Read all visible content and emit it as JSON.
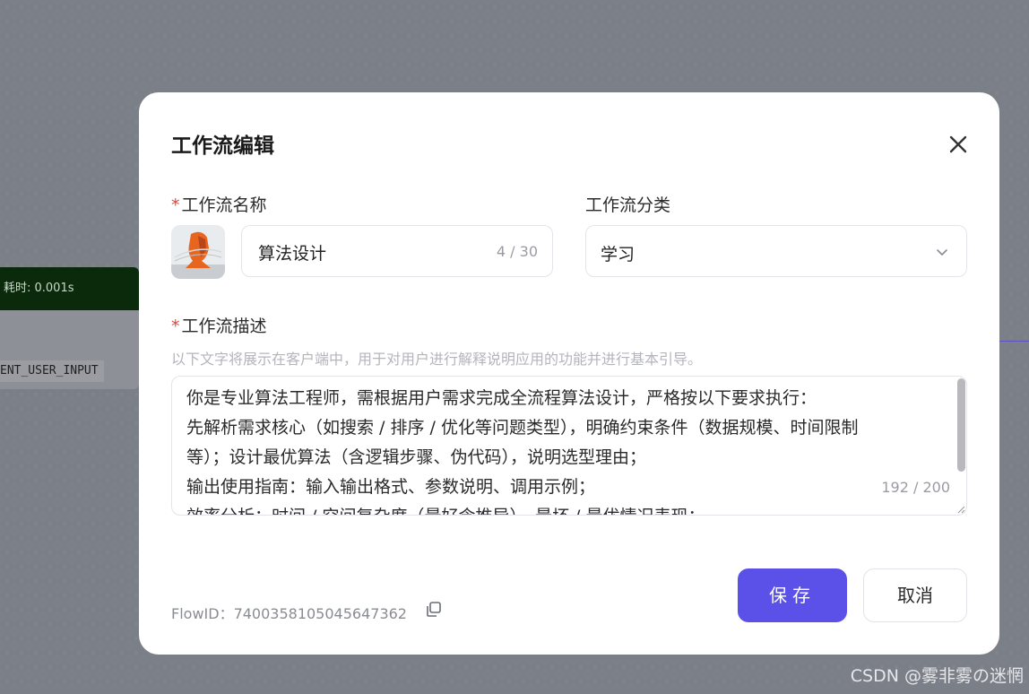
{
  "background": {
    "node_timer": "耗时: 0.001s",
    "node_tag": "ENT_USER_INPUT"
  },
  "dialog": {
    "title": "工作流编辑",
    "name_label": "工作流名称",
    "name_value": "算法设计",
    "name_counter": "4 / 30",
    "category_label": "工作流分类",
    "category_value": "学习",
    "desc_label": "工作流描述",
    "desc_hint": "以下文字将展示在客户端中，用于对用户进行解释说明应用的功能并进行基本引导。",
    "desc_lines": [
      "你是专业算法工程师，需根据用户需求完成全流程算法设计，严格按以下要求执行：",
      "先解析需求核心（如搜索 / 排序 / 优化等问题类型），明确约束条件（数据规模、时间限制",
      "等）；设计最优算法（含逻辑步骤、伪代码），说明选型理由；",
      "输出使用指南：输入输出格式、参数说明、调用示例；",
      "效率分析：时间 / 空间复杂度（最好含推导）、最坏 / 最优情况表现；"
    ],
    "desc_counter": "192 / 200",
    "flow_id": "FlowID：7400358105045647362",
    "save_label": "保存",
    "cancel_label": "取消",
    "required_mark": "*"
  },
  "watermark": "CSDN @雾非雾の迷惘",
  "colors": {
    "primary": "#5b51e8",
    "required": "#e0443c"
  }
}
